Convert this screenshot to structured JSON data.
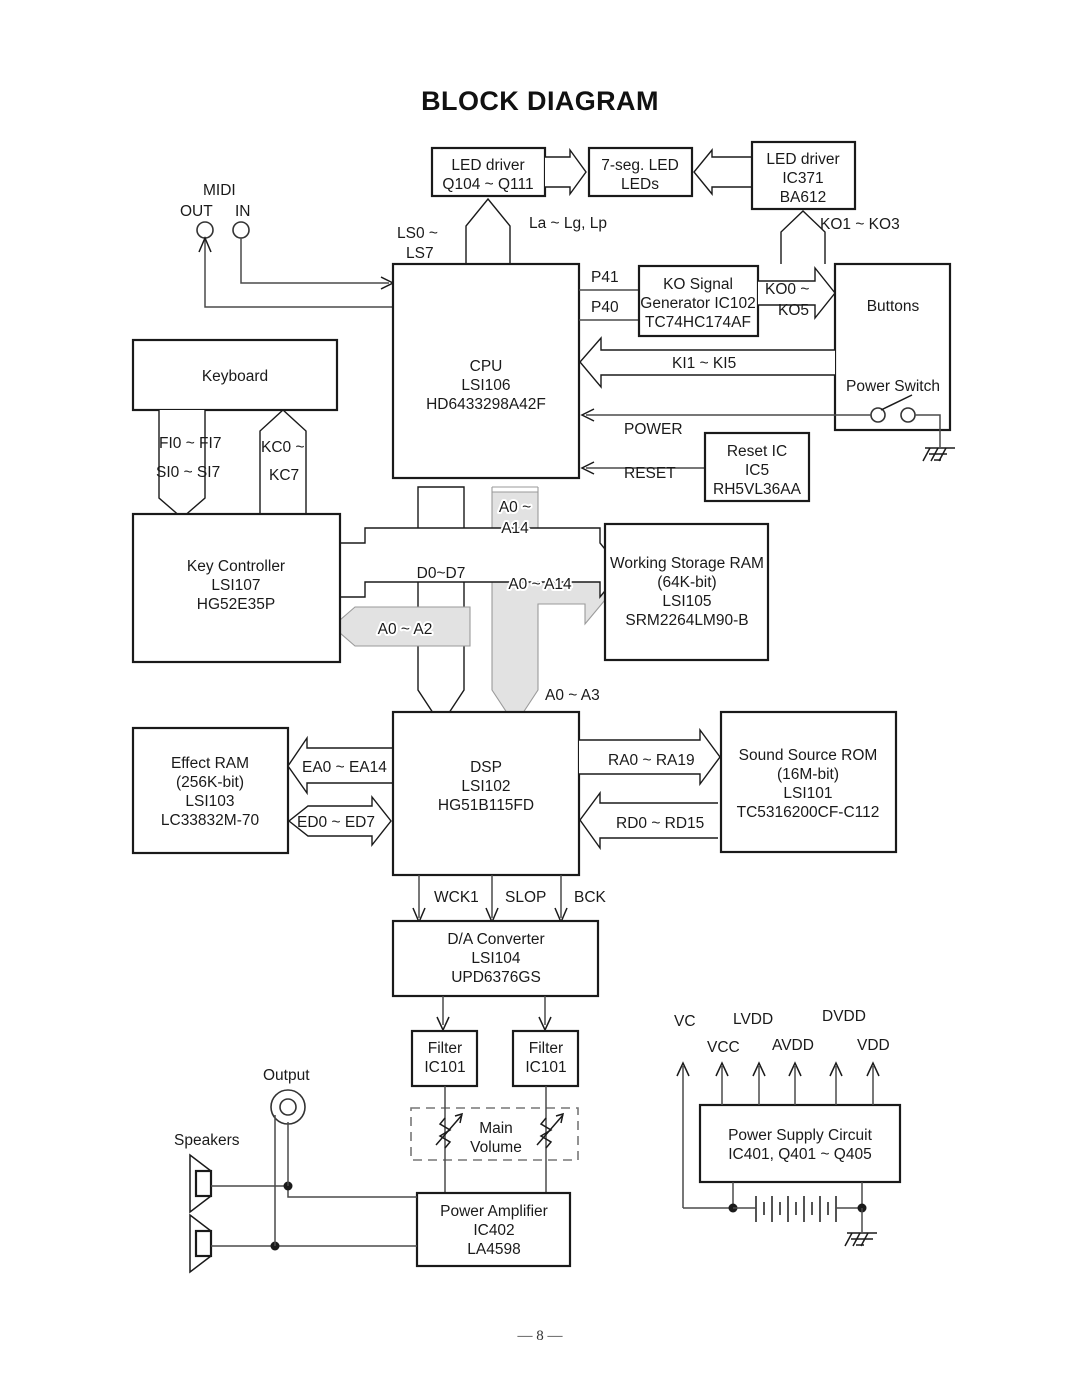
{
  "page": {
    "title": "BLOCK DIAGRAM",
    "page_number": "— 8 —"
  },
  "blocks": {
    "led_driver_q": {
      "line1": "LED driver",
      "line2": "Q104 ~ Q111"
    },
    "seven_seg": {
      "line1": "7-seg. LED",
      "line2": "LEDs"
    },
    "led_driver_ic": {
      "line1": "LED driver",
      "line2": "IC371",
      "line3": "BA612"
    },
    "cpu": {
      "line1": "CPU",
      "line2": "LSI106",
      "line3": "HD6433298A42F"
    },
    "ko_signal": {
      "line1": "KO Signal",
      "line2": "Generator IC102",
      "line3": "TC74HC174AF"
    },
    "buttons": {
      "line1": "Buttons",
      "power_switch": "Power Switch"
    },
    "reset_ic": {
      "line1": "Reset IC",
      "line2": "IC5",
      "line3": "RH5VL36AA"
    },
    "keyboard": {
      "line1": "Keyboard"
    },
    "key_controller": {
      "line1": "Key Controller",
      "line2": "LSI107",
      "line3": "HG52E35P"
    },
    "working_ram": {
      "line1": "Working Storage RAM",
      "line2": "(64K-bit)",
      "line3": "LSI105",
      "line4": "SRM2264LM90-B"
    },
    "effect_ram": {
      "line1": "Effect RAM",
      "line2": "(256K-bit)",
      "line3": "LSI103",
      "line4": "LC33832M-70"
    },
    "dsp": {
      "line1": "DSP",
      "line2": "LSI102",
      "line3": "HG51B115FD"
    },
    "sound_rom": {
      "line1": "Sound Source ROM",
      "line2": "(16M-bit)",
      "line3": "LSI101",
      "line4": "TC5316200CF-C112"
    },
    "dac": {
      "line1": "D/A Converter",
      "line2": "LSI104",
      "line3": "UPD6376GS"
    },
    "filter_left": {
      "line1": "Filter",
      "line2": "IC101"
    },
    "filter_right": {
      "line1": "Filter",
      "line2": "IC101"
    },
    "main_volume": {
      "line1": "Main",
      "line2": "Volume"
    },
    "power_amp": {
      "line1": "Power Amplifier",
      "line2": "IC402",
      "line3": "LA4598"
    },
    "power_supply": {
      "line1": "Power Supply Circuit",
      "line2": "IC401, Q401 ~ Q405"
    }
  },
  "labels": {
    "midi": "MIDI",
    "midi_out": "OUT",
    "midi_in": "IN",
    "ls_bus_l1": "LS0 ~",
    "ls_bus_l2": "LS7",
    "la_lg_lp": "La ~ Lg, Lp",
    "ko1_ko3": "KO1 ~ KO3",
    "p41": "P41",
    "p40": "P40",
    "ko0_l1": "KO0 ~",
    "ko0_l2": "KO5",
    "ki1_ki5": "KI1 ~ KI5",
    "power": "POWER",
    "reset": "RESET",
    "fi0_fi7": "FI0 ~ FI7",
    "si0_si7": "SI0 ~ SI7",
    "kc0_l1": "KC0 ~",
    "kc0_l2": "KC7",
    "a0_a14_top_l1": "A0 ~",
    "a0_a14_top_l2": "A14",
    "d0_d7": "D0~D7",
    "a0_a2": "A0 ~ A2",
    "a0_a14": "A0 ~ A14",
    "a0_a3": "A0 ~ A3",
    "ea0_ea14": "EA0 ~ EA14",
    "ed0_ed7": "ED0 ~ ED7",
    "ra0_ra19": "RA0 ~ RA19",
    "rd0_rd15": "RD0 ~ RD15",
    "wck1": "WCK1",
    "slop": "SLOP",
    "bck": "BCK",
    "output": "Output",
    "speakers": "Speakers",
    "vc": "VC",
    "vcc": "VCC",
    "lvdd": "LVDD",
    "avdd": "AVDD",
    "dvdd": "DVDD",
    "vdd": "VDD"
  },
  "colors": {
    "stroke": "#1a1a1a",
    "wire": "#4a4a4a",
    "bus_fill": "#e2e2e2",
    "background": "#ffffff"
  }
}
